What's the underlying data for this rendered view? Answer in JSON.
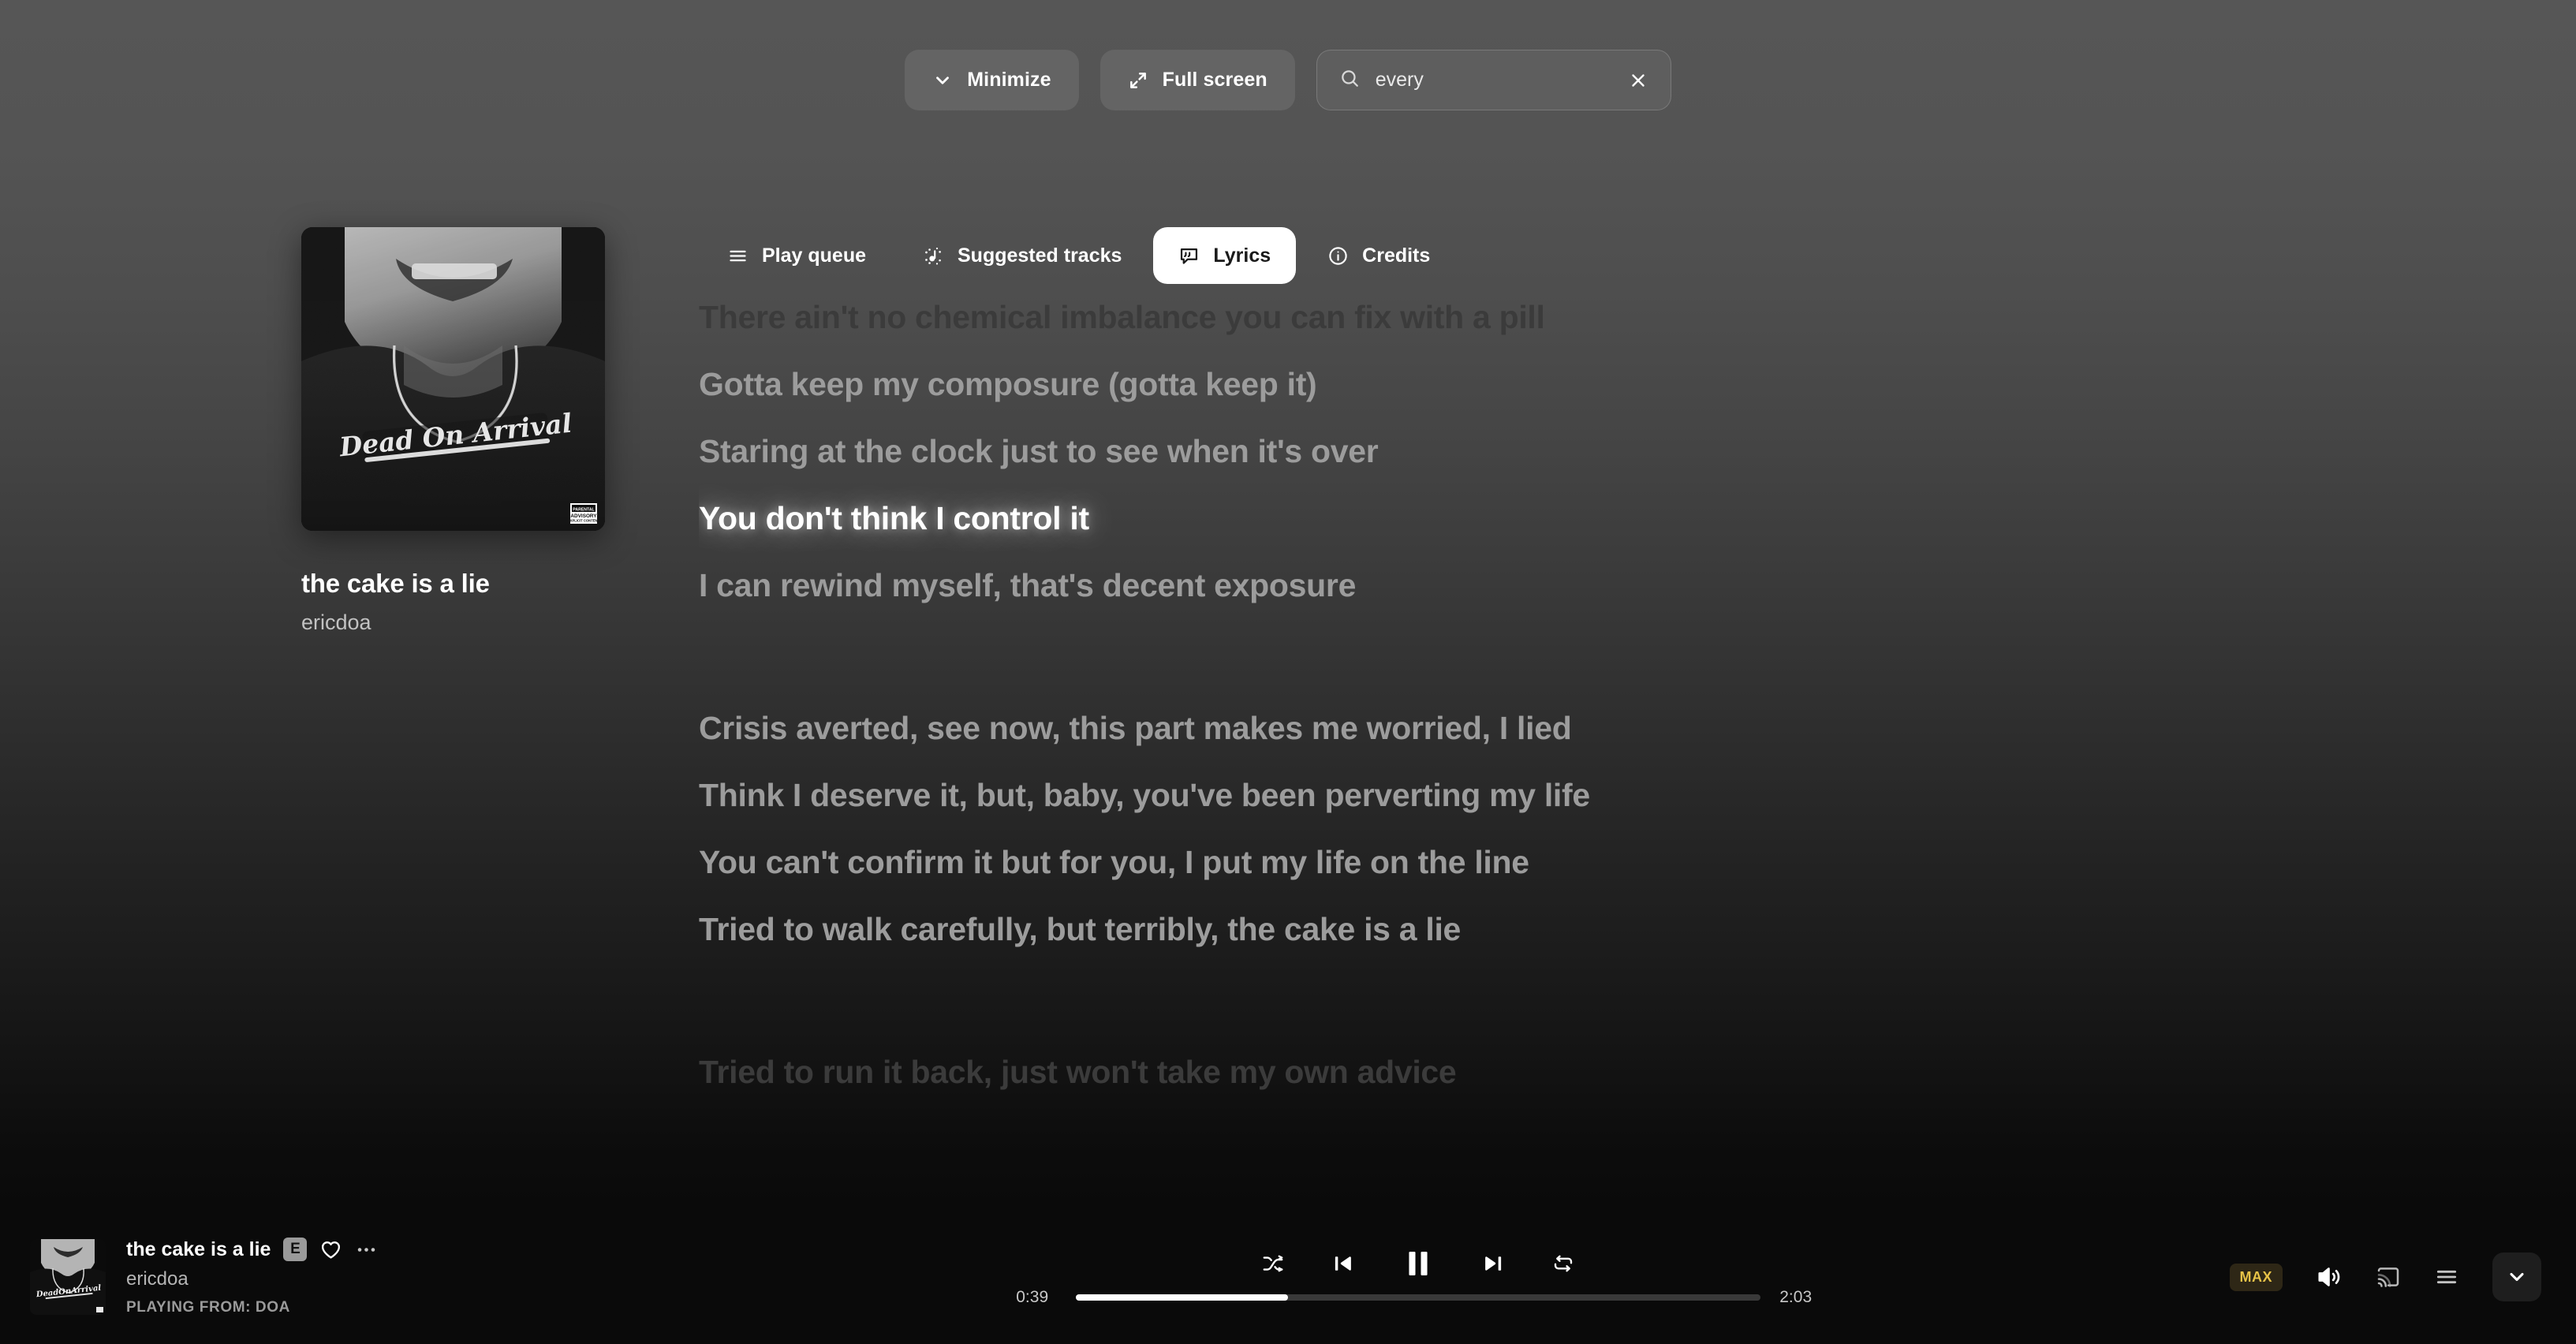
{
  "topbar": {
    "minimize_label": "Minimize",
    "fullscreen_label": "Full screen",
    "search_value": "every",
    "search_placeholder": "Search"
  },
  "now_playing": {
    "title": "the cake is a lie",
    "artist": "ericdoa",
    "album_art_alt": "Dead On Arrival nameplate necklace",
    "parental_advisory": "PARENTAL ADVISORY EXPLICIT CONTENT"
  },
  "tabs": [
    {
      "label": "Play queue",
      "icon": "queue-icon",
      "active": false
    },
    {
      "label": "Suggested tracks",
      "icon": "sparkle-note-icon",
      "active": false
    },
    {
      "label": "Lyrics",
      "icon": "lyrics-bubble-icon",
      "active": true
    },
    {
      "label": "Credits",
      "icon": "info-icon",
      "active": false
    }
  ],
  "lyrics": [
    {
      "text": "There ain't no chemical imbalance you can fix with a pill",
      "state": "faint"
    },
    {
      "text": "Gotta keep my composure (gotta keep it)",
      "state": "dim"
    },
    {
      "text": "Staring at the clock just to see when it's over",
      "state": "dim"
    },
    {
      "text": "You don't think I control it",
      "state": "active"
    },
    {
      "text": "I can rewind myself, that's decent exposure",
      "state": "dim"
    },
    {
      "text": "",
      "state": "spacer"
    },
    {
      "text": "Crisis averted, see now, this part makes me worried, I lied",
      "state": "dim"
    },
    {
      "text": "Think I deserve it, but, baby, you've been perverting my life",
      "state": "dim"
    },
    {
      "text": "You can't confirm it but for you, I put my life on the line",
      "state": "dim"
    },
    {
      "text": "Tried to walk carefully, but terribly, the cake is a lie",
      "state": "dim"
    },
    {
      "text": "",
      "state": "spacer"
    },
    {
      "text": "Tried to run it back, just won't take my own advice",
      "state": "faint"
    }
  ],
  "player": {
    "title": "the cake is a lie",
    "explicit_badge": "E",
    "artist": "ericdoa",
    "playing_from": "PLAYING FROM: DOA",
    "elapsed": "0:39",
    "duration": "2:03",
    "progress_percent": 31,
    "quality_badge": "MAX",
    "is_playing": true,
    "controls": {
      "shuffle": "shuffle-icon",
      "previous": "previous-track-icon",
      "playpause": "pause-icon",
      "next": "next-track-icon",
      "repeat": "repeat-icon",
      "like": "heart-icon",
      "more": "more-options-icon",
      "volume": "volume-icon",
      "cast": "cast-icon",
      "queue": "queue-list-icon",
      "collapse": "chevron-down-icon"
    }
  },
  "colors": {
    "accent_quality": "#e7c247",
    "active_lyric": "#ffffff",
    "inactive_lyric": "#9c9c9c",
    "player_background": "#0a0a0a"
  }
}
